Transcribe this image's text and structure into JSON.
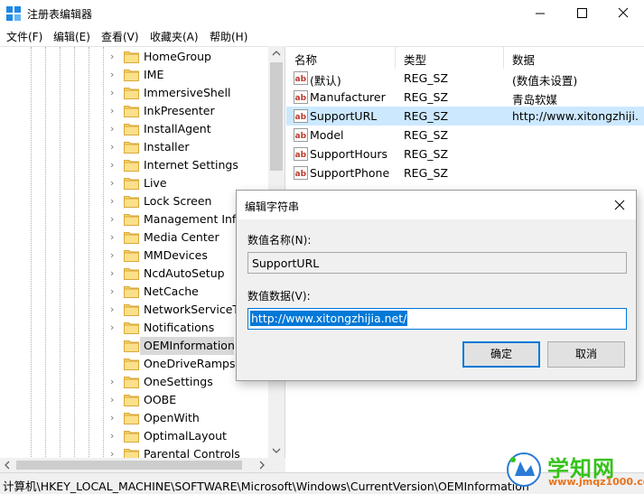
{
  "window": {
    "title": "注册表编辑器"
  },
  "menu": [
    "文件(F)",
    "编辑(E)",
    "查看(V)",
    "收藏夹(A)",
    "帮助(H)"
  ],
  "tree": {
    "items": [
      {
        "label": "HomeGroup",
        "expandable": true
      },
      {
        "label": "IME",
        "expandable": true
      },
      {
        "label": "ImmersiveShell",
        "expandable": true
      },
      {
        "label": "InkPresenter",
        "expandable": true
      },
      {
        "label": "InstallAgent",
        "expandable": true
      },
      {
        "label": "Installer",
        "expandable": true
      },
      {
        "label": "Internet Settings",
        "expandable": true
      },
      {
        "label": "Live",
        "expandable": true
      },
      {
        "label": "Lock Screen",
        "expandable": true
      },
      {
        "label": "Management Infr",
        "expandable": true
      },
      {
        "label": "Media Center",
        "expandable": true
      },
      {
        "label": "MMDevices",
        "expandable": true
      },
      {
        "label": "NcdAutoSetup",
        "expandable": true
      },
      {
        "label": "NetCache",
        "expandable": true
      },
      {
        "label": "NetworkServiceTr",
        "expandable": true
      },
      {
        "label": "Notifications",
        "expandable": true
      },
      {
        "label": "OEMInformation",
        "expandable": false,
        "selected": true
      },
      {
        "label": "OneDriveRamps",
        "expandable": false
      },
      {
        "label": "OneSettings",
        "expandable": true
      },
      {
        "label": "OOBE",
        "expandable": true
      },
      {
        "label": "OpenWith",
        "expandable": true
      },
      {
        "label": "OptimalLayout",
        "expandable": true
      },
      {
        "label": "Parental Controls",
        "expandable": true
      }
    ]
  },
  "list": {
    "headers": {
      "name": "名称",
      "type": "类型",
      "data": "数据"
    },
    "rows": [
      {
        "name": "(默认)",
        "type": "REG_SZ",
        "data": "(数值未设置)"
      },
      {
        "name": "Manufacturer",
        "type": "REG_SZ",
        "data": "青岛软媒"
      },
      {
        "name": "SupportURL",
        "type": "REG_SZ",
        "data": "http://www.xitongzhiji...",
        "selected": true
      },
      {
        "name": "Model",
        "type": "REG_SZ",
        "data": ""
      },
      {
        "name": "SupportHours",
        "type": "REG_SZ",
        "data": ""
      },
      {
        "name": "SupportPhone",
        "type": "REG_SZ",
        "data": ""
      }
    ]
  },
  "status": {
    "path": "计算机\\HKEY_LOCAL_MACHINE\\SOFTWARE\\Microsoft\\Windows\\CurrentVersion\\OEMInformation"
  },
  "dialog": {
    "title": "编辑字符串",
    "name_label": "数值名称(N):",
    "name_value": "SupportURL",
    "data_label": "数值数据(V):",
    "data_value": "http://www.xitongzhijia.net/",
    "ok_label": "确定",
    "cancel_label": "取消"
  },
  "watermark": {
    "title": "学知网",
    "url": "www.jmqz1000.com"
  },
  "colors": {
    "selection": "#cce8ff",
    "accent": "#0078d7",
    "watermark_green": "#35c21a",
    "watermark_orange": "#e8731c"
  }
}
